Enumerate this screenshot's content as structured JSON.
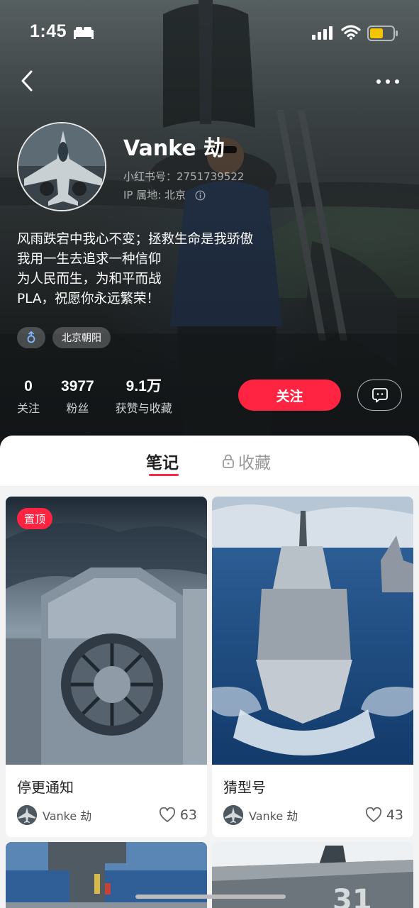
{
  "status_bar": {
    "time": "1:45",
    "icons": [
      "bed-icon",
      "signal-icon",
      "wifi-icon",
      "battery-icon"
    ],
    "battery_color": "#f5c400"
  },
  "nav": {
    "back_icon": "chevron-left-icon",
    "more_icon": "more-dots-icon"
  },
  "profile": {
    "username": "Vanke 劫",
    "id_line": "小红书号：2751739522",
    "ip_line": "IP 属地: 北京",
    "bio": [
      "风雨跌宕中我心不变；拯救生命是我骄傲",
      "我用一生去追求一种信仰",
      "为人民而生，为和平而战",
      "PLA，祝愿你永远繁荣！"
    ],
    "gender_icon": "male-icon",
    "location_tag": "北京朝阳"
  },
  "stats": [
    {
      "value": "0",
      "label": "关注"
    },
    {
      "value": "3977",
      "label": "粉丝"
    },
    {
      "value": "9.1万",
      "label": "获赞与收藏"
    }
  ],
  "actions": {
    "follow_label": "关注",
    "chat_icon": "chat-bubble-icon"
  },
  "tabs": [
    {
      "label": "笔记",
      "active": true
    },
    {
      "label": "收藏",
      "active": false,
      "icon": "lock-icon"
    }
  ],
  "notes": [
    {
      "title": "停更通知",
      "author": "Vanke 劫",
      "likes": "63",
      "badge": "置顶"
    },
    {
      "title": "猜型号",
      "author": "Vanke 劫",
      "likes": "43"
    }
  ],
  "colors": {
    "accent": "#ff2442"
  }
}
